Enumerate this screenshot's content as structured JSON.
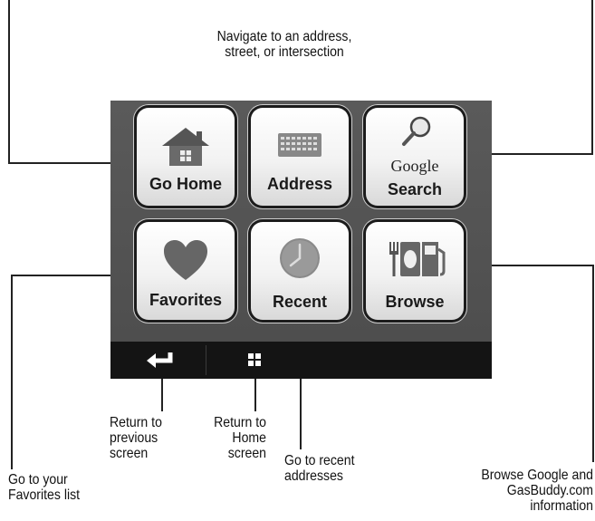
{
  "screen": {
    "buttons": {
      "go_home": "Go Home",
      "address": "Address",
      "google_search_brand": "Google",
      "google_search": "Search",
      "favorites": "Favorites",
      "recent": "Recent",
      "browse": "Browse"
    }
  },
  "callouts": {
    "address": "Navigate to an address,\nstreet, or intersection",
    "back": "Return to\nprevious\nscreen",
    "home_screen": "Return to\nHome\nscreen",
    "recent": "Go to recent\naddresses",
    "favorites": "Go to your\nFavorites list",
    "browse": "Browse Google and\nGasBuddy.com\ninformation"
  },
  "colors": {
    "screen_bg": "#4f4f4f",
    "toolbar_bg": "#141414",
    "button_face": "#f2f2f2"
  },
  "icons": {
    "go_home": "house-icon",
    "address": "keyboard-icon",
    "google_search": "magnifier-icon",
    "favorites": "heart-icon",
    "recent": "clock-icon",
    "browse": "fork-gas-pump-icon",
    "back": "back-arrow-icon",
    "home": "grid-icon"
  }
}
